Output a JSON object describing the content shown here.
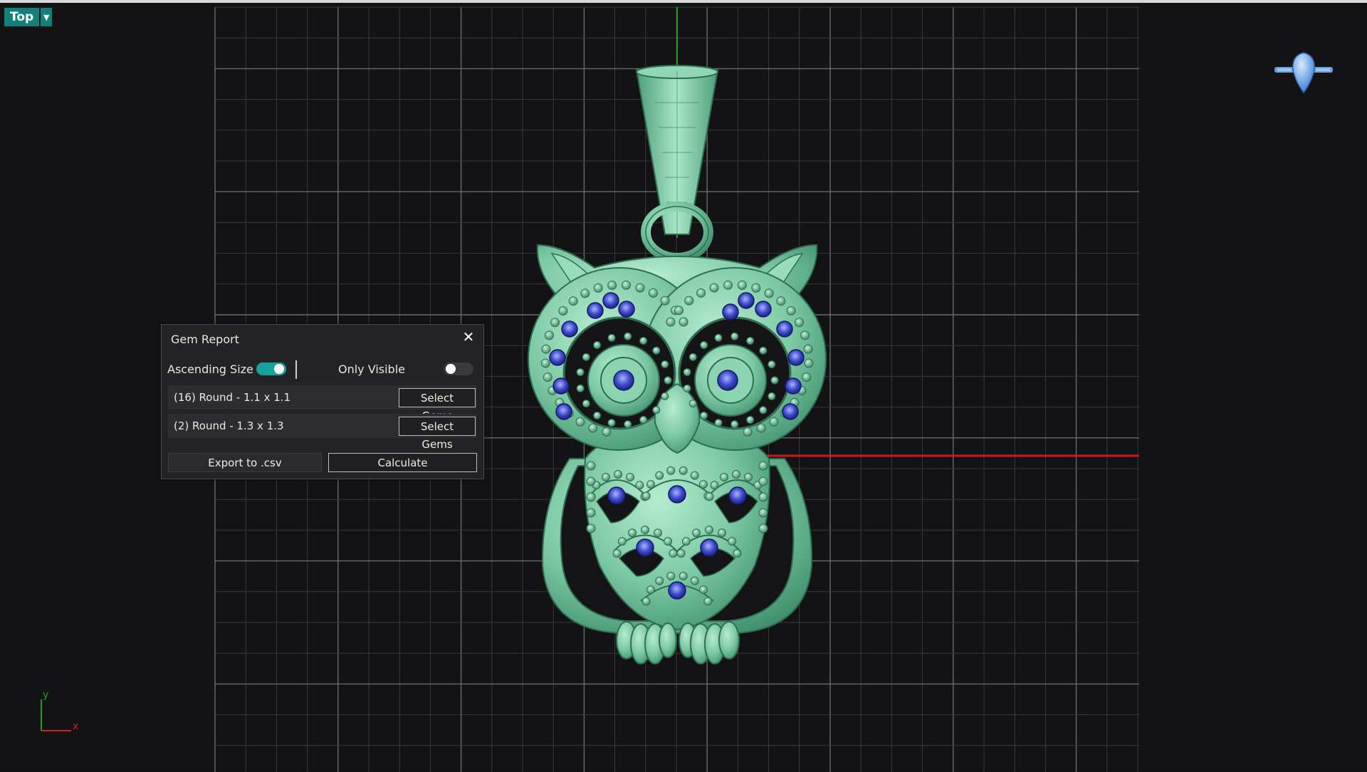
{
  "viewport": {
    "label": "Top",
    "dropdown_icon": "triangle-down-icon",
    "axis_x": "x",
    "axis_y": "y",
    "colors": {
      "background": "#131315",
      "grid_minor": "#3a3a3c",
      "grid_major": "#6a6a6c",
      "axis_x": "#d01818",
      "axis_y": "#1aa21a",
      "model": "#7cc9a3",
      "gem": "#3b45c7"
    }
  },
  "gem_report": {
    "title": "Gem Report",
    "close_icon": "close-icon",
    "ascending_size_label": "Ascending Size",
    "ascending_size_on": true,
    "only_visible_label": "Only Visible",
    "only_visible_on": false,
    "rows": [
      {
        "label": "(16) Round - 1.1 x 1.1",
        "button": "Select Gems"
      },
      {
        "label": "(2) Round - 1.3 x 1.3",
        "button": "Select Gems"
      }
    ],
    "export_label": "Export to .csv",
    "calculate_label": "Calculate",
    "accent": "#16a39b"
  }
}
